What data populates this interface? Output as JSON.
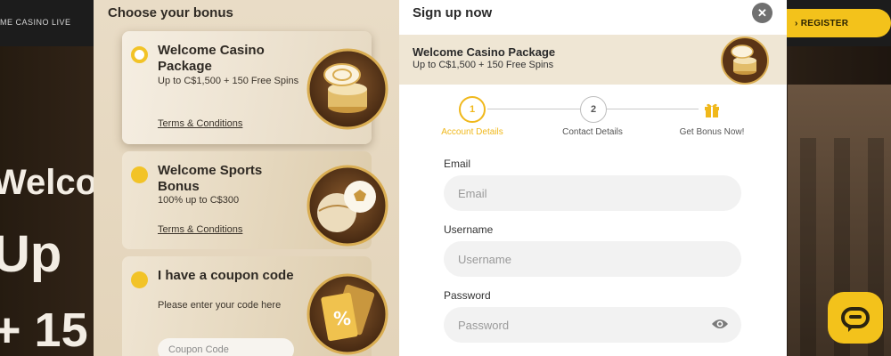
{
  "background": {
    "nav_text": "ME   CASINO   LIVE",
    "register_label": "› REGISTER",
    "hero_line1": "Welco",
    "hero_line2": "Up",
    "hero_line3": "+ 15"
  },
  "bonus_panel": {
    "heading": "Choose your bonus",
    "options": [
      {
        "title": "Welcome Casino Package",
        "description": "Up to C$1,500 + 150 Free Spins",
        "terms": "Terms & Conditions",
        "icon": "casino-chips-icon",
        "selected": true
      },
      {
        "title": "Welcome Sports Bonus",
        "description": "100% up to C$300",
        "terms": "Terms & Conditions",
        "icon": "sports-balls-icon",
        "selected": false
      },
      {
        "title": "I have a coupon code",
        "description": "Please enter your code here",
        "coupon_placeholder": "Coupon Code",
        "icon": "coupon-tickets-icon",
        "selected": false
      }
    ]
  },
  "signup": {
    "title": "Sign up now",
    "package": {
      "name": "Welcome Casino Package",
      "description": "Up to C$1,500 + 150 Free Spins"
    },
    "steps": [
      {
        "number": "1",
        "label": "Account Details",
        "active": true
      },
      {
        "number": "2",
        "label": "Contact Details",
        "active": false
      },
      {
        "number": "",
        "label": "Get Bonus Now!",
        "icon": "gift-icon",
        "active": false
      }
    ],
    "fields": {
      "email": {
        "label": "Email",
        "placeholder": "Email",
        "value": ""
      },
      "username": {
        "label": "Username",
        "placeholder": "Username",
        "value": ""
      },
      "password": {
        "label": "Password",
        "placeholder": "Password",
        "value": ""
      }
    }
  },
  "colors": {
    "accent": "#f0b81b",
    "panel_beige": "#e9dcc6",
    "banner_beige": "#efe6d4",
    "close_grey": "#707070"
  }
}
